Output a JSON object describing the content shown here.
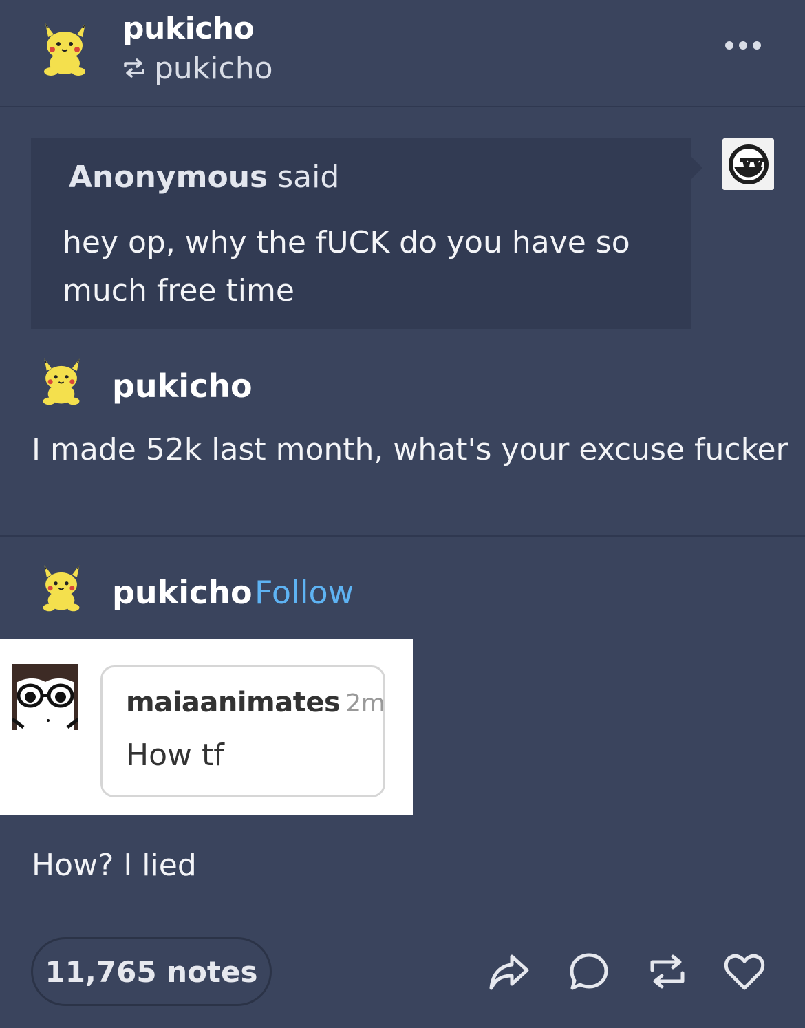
{
  "header": {
    "author": "pukicho",
    "reblogged_from": "pukicho",
    "more_icon": "ellipsis-icon"
  },
  "ask": {
    "asker": "Anonymous",
    "asked_word": "said",
    "question": "hey op, why the fUCK do you have so much free time",
    "asker_avatar_icon": "sunglasses-face-icon"
  },
  "reply": {
    "author": "pukicho",
    "text": "I made 52k last month, what's your excuse fucker"
  },
  "reblog": {
    "author": "pukicho",
    "follow_label": "Follow",
    "embedded_comment": {
      "username": "maiaanimates",
      "time": "2m",
      "text": "How tf"
    },
    "text": "How? I lied"
  },
  "footer": {
    "notes_label": "11,765 notes",
    "actions": [
      "share-icon",
      "reply-icon",
      "reblog-icon",
      "like-icon"
    ]
  },
  "colors": {
    "background": "#3a445d",
    "ask_background": "#323b53",
    "link": "#5eb3f3"
  }
}
